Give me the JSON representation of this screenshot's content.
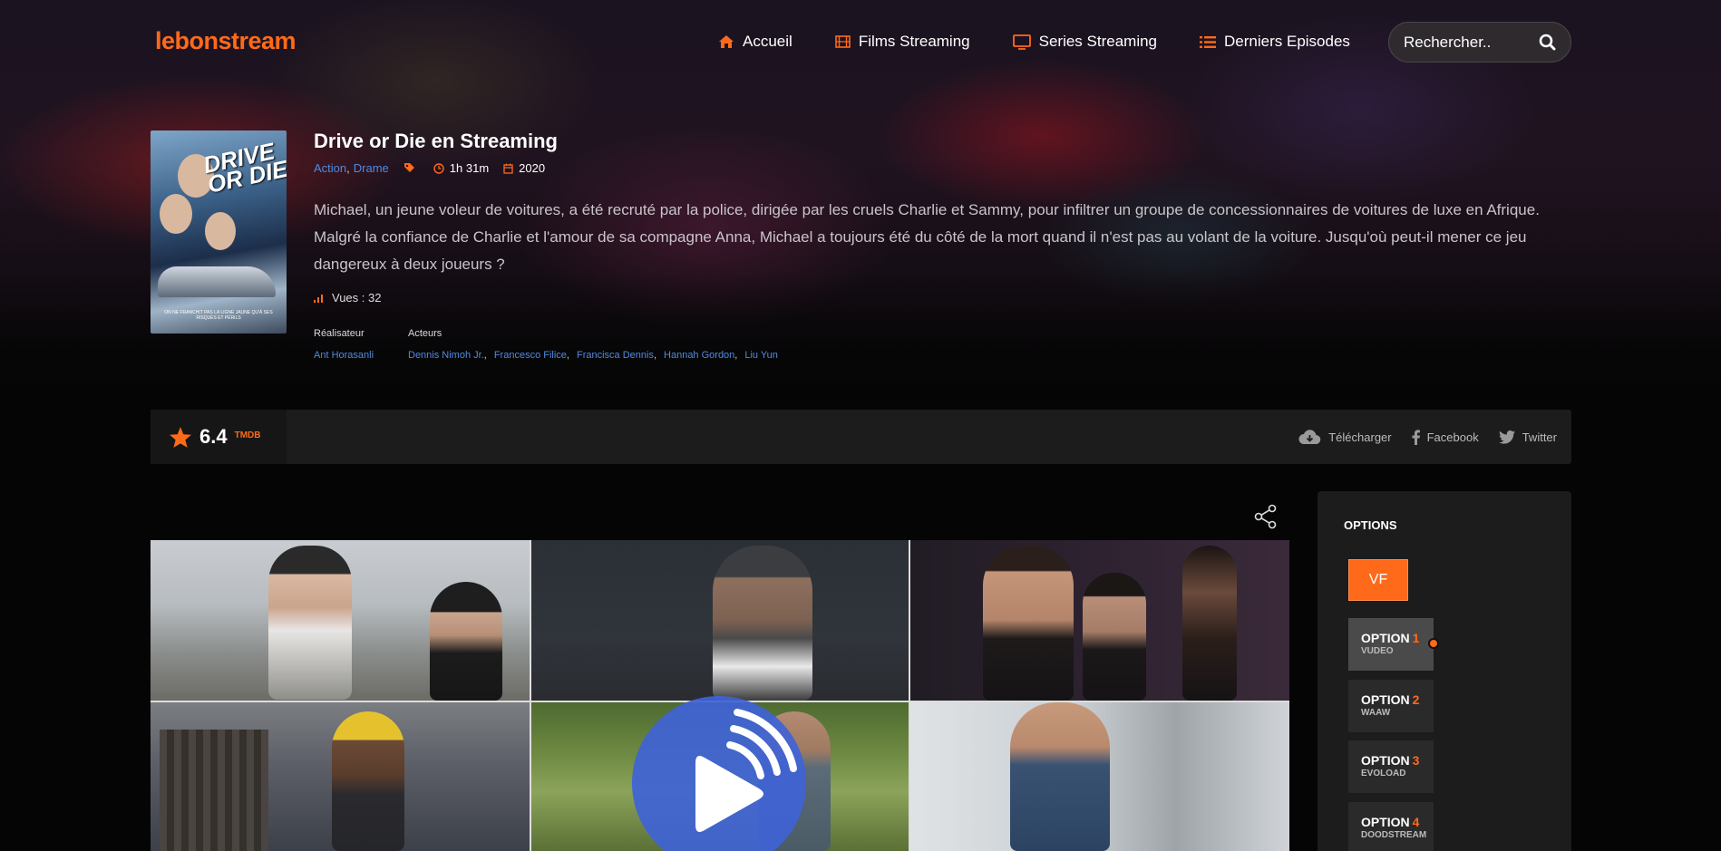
{
  "site": {
    "logo": "lebonstream"
  },
  "nav": {
    "items": [
      {
        "label": "Accueil",
        "icon": "home-icon"
      },
      {
        "label": "Films Streaming",
        "icon": "film-icon"
      },
      {
        "label": "Series Streaming",
        "icon": "tv-icon"
      },
      {
        "label": "Derniers Episodes",
        "icon": "list-icon"
      }
    ]
  },
  "search": {
    "placeholder": "Rechercher.."
  },
  "film": {
    "title": "Drive or Die en Streaming",
    "genres": [
      "Action",
      "Drame"
    ],
    "duration": "1h 31m",
    "year": "2020",
    "synopsis": "Michael, un jeune voleur de voitures, a été recruté par la police, dirigée par les cruels Charlie et Sammy, pour infiltrer un groupe de concessionnaires de voitures de luxe en Afrique. Malgré la confiance de Charlie et l'amour de sa compagne Anna, Michael a toujours été du côté de la mort quand il n'est pas au volant de la voiture. Jusqu'où peut-il mener ce jeu dangereux à deux joueurs ?",
    "views": "Vues : 32",
    "director_label": "Réalisateur",
    "director": "Ant Horasanli",
    "actors_label": "Acteurs",
    "actors": [
      "Dennis Nimoh Jr.",
      "Francesco Filice",
      "Francisca Dennis",
      "Hannah Gordon",
      "Liu Yun"
    ],
    "poster": {
      "title_line1": "DRIVE",
      "title_line2": "OR DIE",
      "caption": "ON NE FRANCHIT PAS LA LIGNE JAUNE QU'À SES RISQUES ET PÉRILS"
    }
  },
  "rating": {
    "value": "6.4",
    "source": "TMDB"
  },
  "share": {
    "download": "Télécharger",
    "facebook": "Facebook",
    "twitter": "Twitter"
  },
  "options": {
    "title": "OPTIONS",
    "language": "VF",
    "items": [
      {
        "label": "OPTION",
        "num": "1",
        "host": "VUDEO",
        "active": true
      },
      {
        "label": "OPTION",
        "num": "2",
        "host": "WAAW",
        "active": false
      },
      {
        "label": "OPTION",
        "num": "3",
        "host": "EVOLOAD",
        "active": false
      },
      {
        "label": "OPTION",
        "num": "4",
        "host": "DOODSTREAM",
        "active": false
      }
    ]
  },
  "colors": {
    "accent": "#ff6a1a",
    "link": "#4f8ae0",
    "play": "#3f63d6"
  }
}
